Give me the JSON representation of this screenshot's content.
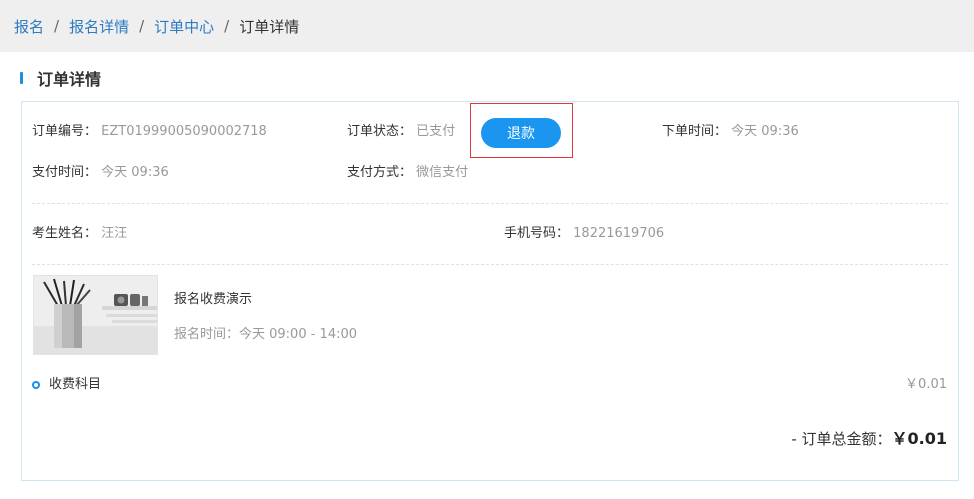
{
  "breadcrumb": {
    "items": [
      "报名",
      "报名详情",
      "订单中心"
    ],
    "separator": "/",
    "current": "订单详情"
  },
  "section": {
    "title": "订单详情"
  },
  "order": {
    "number_label": "订单编号：",
    "number_value": "EZT01999005090002718",
    "status_label": "订单状态：",
    "status_value": "已支付",
    "refund_label": "退款",
    "created_label": "下单时间：",
    "created_value": "今天 09:36",
    "paid_time_label": "支付时间：",
    "paid_time_value": "今天 09:36",
    "pay_method_label": "支付方式：",
    "pay_method_value": "微信支付"
  },
  "candidate": {
    "name_label": "考生姓名：",
    "name_value": "汪汪",
    "phone_label": "手机号码：",
    "phone_value": "18221619706"
  },
  "product": {
    "name": "报名收费演示",
    "time_text": "报名时间：今天 09:00 - 14:00"
  },
  "fee": {
    "label": "收费科目",
    "amount": "￥0.01"
  },
  "total": {
    "label": "- 订单总金额：",
    "amount": "￥0.01"
  },
  "colors": {
    "accent": "#1a96f0",
    "link": "#2e7bc2",
    "highlight_border": "#e0363d"
  }
}
